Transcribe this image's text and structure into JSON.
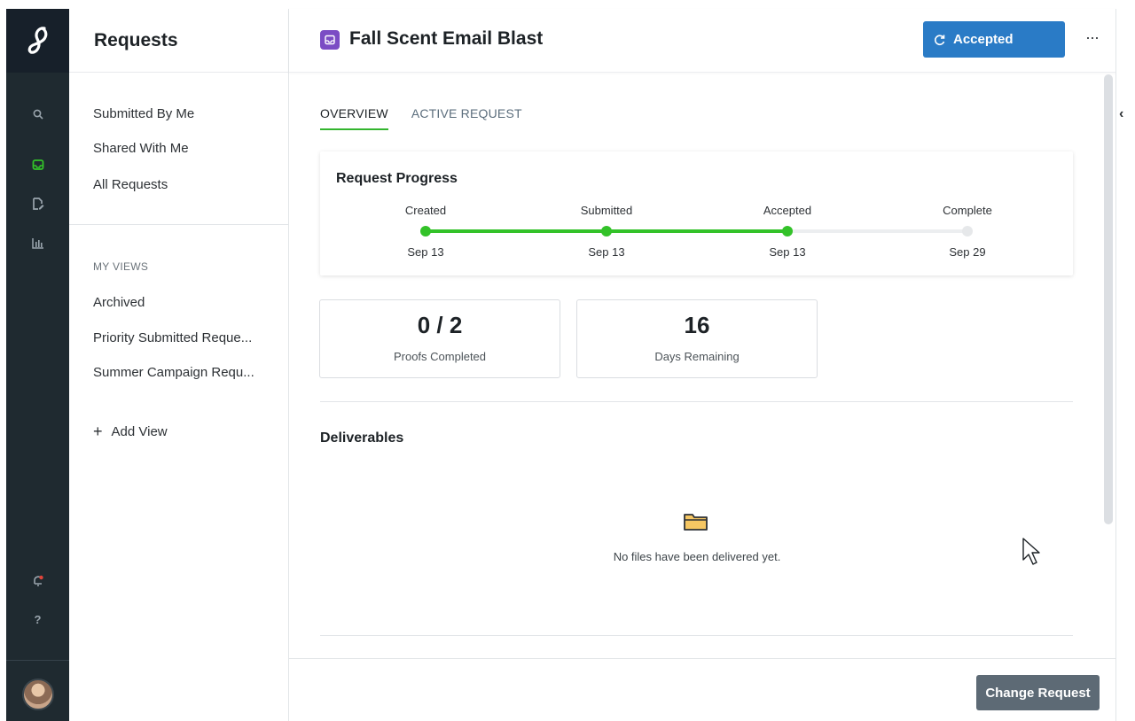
{
  "sidebar": {
    "title": "Requests",
    "items": [
      {
        "label": "Submitted By Me"
      },
      {
        "label": "Shared With Me"
      },
      {
        "label": "All Requests"
      }
    ],
    "views_heading": "MY VIEWS",
    "views": [
      {
        "label": "Archived"
      },
      {
        "label": "Priority Submitted Reque..."
      },
      {
        "label": "Summer Campaign Requ..."
      }
    ],
    "add_view": {
      "icon": "+",
      "label": "Add View"
    }
  },
  "rail": {
    "icons": [
      "logo-icon",
      "search-icon",
      "inbox-icon",
      "edit-document-icon",
      "bar-chart-icon",
      "notification-bell-icon",
      "help-icon",
      "avatar"
    ],
    "active_color": "#33c229",
    "help_glyph": "?"
  },
  "header": {
    "title": "Fall Scent Email Blast",
    "status_label": "Accepted",
    "more_label": "···",
    "title_icon_color": "#7b4cc4",
    "status_color": "#2a7bc6"
  },
  "tabs": [
    {
      "label": "OVERVIEW",
      "active": true
    },
    {
      "label": "ACTIVE REQUEST",
      "active": false
    }
  ],
  "progress": {
    "title": "Request Progress",
    "stages": [
      {
        "label": "Created",
        "date": "Sep 13",
        "done": true
      },
      {
        "label": "Submitted",
        "date": "Sep 13",
        "done": true
      },
      {
        "label": "Accepted",
        "date": "Sep 13",
        "done": true
      },
      {
        "label": "Complete",
        "date": "Sep 29",
        "done": false
      }
    ],
    "complete_color": "#33c229"
  },
  "stats": [
    {
      "value": "0 / 2",
      "caption": "Proofs Completed"
    },
    {
      "value": "16",
      "caption": "Days Remaining"
    }
  ],
  "deliverables": {
    "title": "Deliverables",
    "empty_text": "No files have been delivered yet."
  },
  "footer": {
    "change_label": "Change Request"
  }
}
